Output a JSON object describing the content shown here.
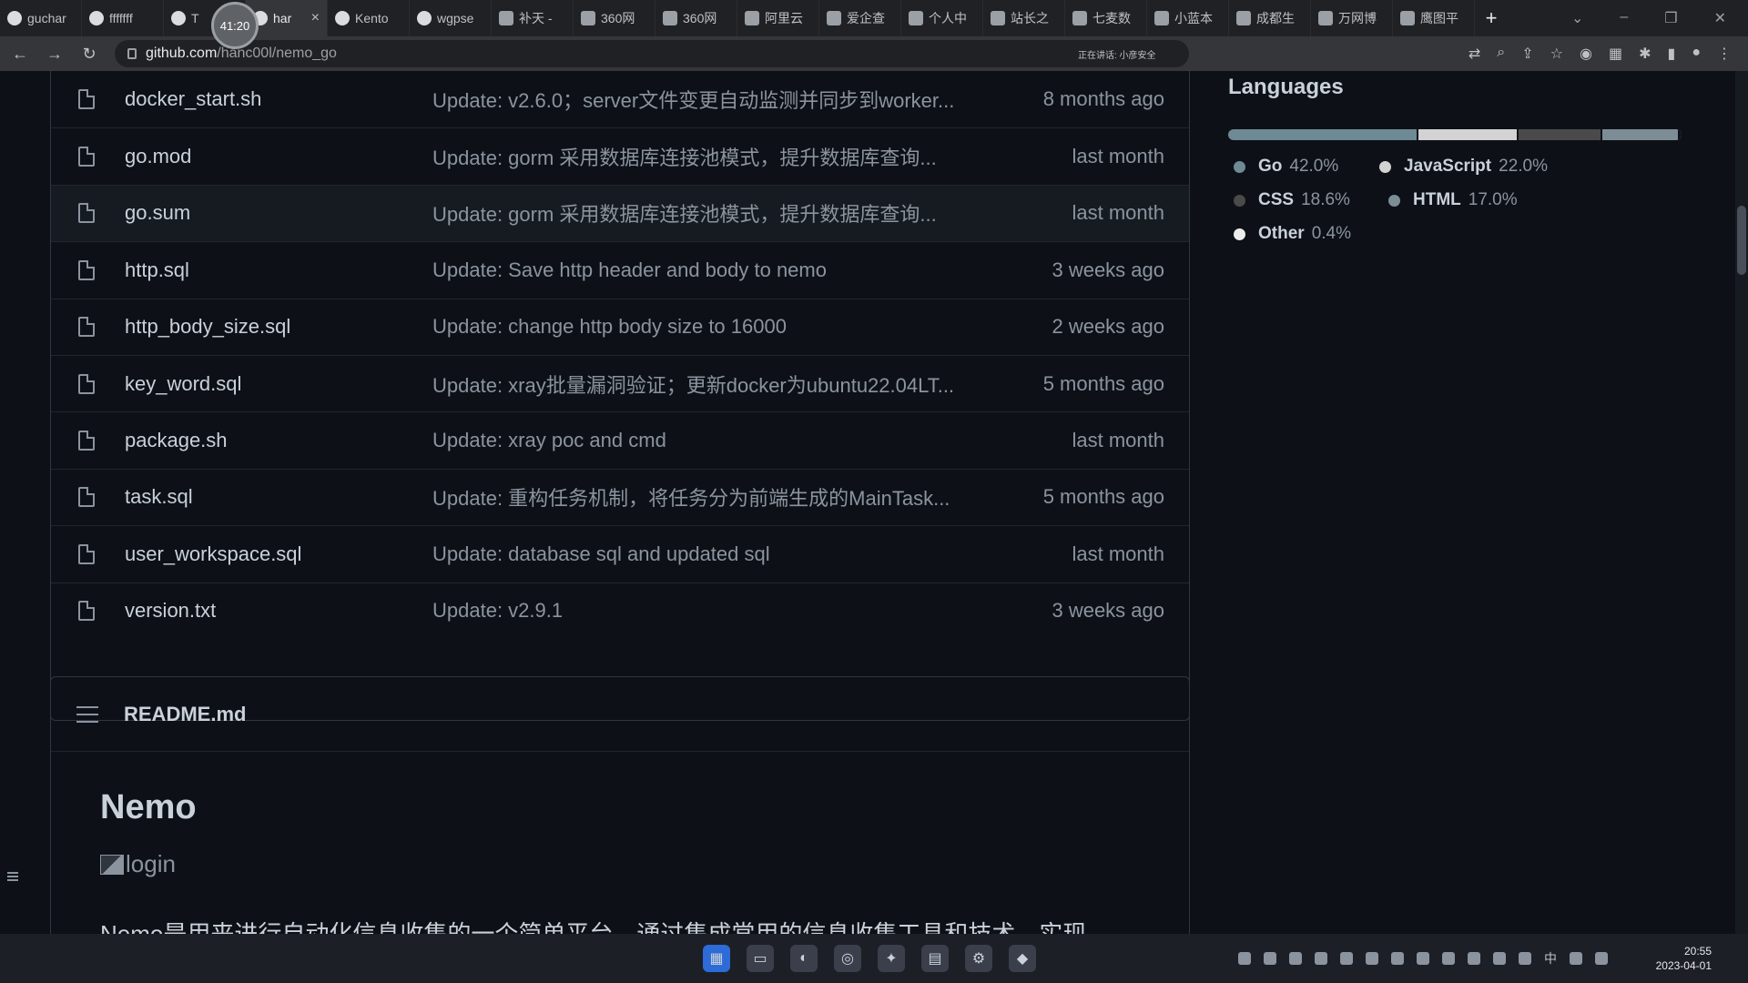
{
  "browser": {
    "tabs": [
      {
        "label": "guchar",
        "icon": "github-icon"
      },
      {
        "label": "fffffff",
        "icon": "github-icon"
      },
      {
        "label": "T",
        "icon": "github-icon"
      },
      {
        "label": "har",
        "icon": "github-icon",
        "active": true
      },
      {
        "label": "Kento",
        "icon": "github-icon"
      },
      {
        "label": "wgpse",
        "icon": "github-icon"
      },
      {
        "label": "补天 -",
        "icon": "site-icon"
      },
      {
        "label": "360网",
        "icon": "site-icon"
      },
      {
        "label": "360网",
        "icon": "site-icon"
      },
      {
        "label": "阿里云",
        "icon": "site-icon"
      },
      {
        "label": "爱企查",
        "icon": "site-icon"
      },
      {
        "label": "个人中",
        "icon": "site-icon"
      },
      {
        "label": "站长之",
        "icon": "site-icon"
      },
      {
        "label": "七麦数",
        "icon": "site-icon"
      },
      {
        "label": "小蓝本",
        "icon": "site-icon"
      },
      {
        "label": "成都生",
        "icon": "site-icon"
      },
      {
        "label": "万网博",
        "icon": "site-icon"
      },
      {
        "label": "鹰图平",
        "icon": "site-icon"
      }
    ],
    "new_tab": "+",
    "timer": "41:20",
    "url_host": "github.com",
    "url_path": "/hanc00l/nemo_go",
    "sync_text": "正在讲话: 小彦安全"
  },
  "files": [
    {
      "name": "docker_start.sh",
      "commit": "Update: v2.6.0；server文件变更自动监测并同步到worker...",
      "time": "8 months ago"
    },
    {
      "name": "go.mod",
      "commit": "Update: gorm 采用数据库连接池模式，提升数据库查询...",
      "time": "last month"
    },
    {
      "name": "go.sum",
      "commit": "Update: gorm 采用数据库连接池模式，提升数据库查询...",
      "time": "last month"
    },
    {
      "name": "http.sql",
      "commit": "Update: Save http header and body to nemo",
      "time": "3 weeks ago"
    },
    {
      "name": "http_body_size.sql",
      "commit": "Update: change http body size to 16000",
      "time": "2 weeks ago"
    },
    {
      "name": "key_word.sql",
      "commit": "Update: xray批量漏洞验证；更新docker为ubuntu22.04LT...",
      "time": "5 months ago"
    },
    {
      "name": "package.sh",
      "commit": "Update: xray poc and cmd",
      "time": "last month"
    },
    {
      "name": "task.sql",
      "commit": "Update: 重构任务机制，将任务分为前端生成的MainTask...",
      "time": "5 months ago"
    },
    {
      "name": "user_workspace.sql",
      "commit": "Update: database sql and updated sql",
      "time": "last month"
    },
    {
      "name": "version.txt",
      "commit": "Update: v2.9.1",
      "time": "3 weeks ago"
    }
  ],
  "readme": {
    "filename": "README.md",
    "heading": "Nemo",
    "image_alt": "login",
    "truncated_line": "Nemo是用来进行自动化信息收集的一个简单平台，通过集成常用的信息收集工具和技术，实现"
  },
  "languages": {
    "title": "Languages",
    "items": [
      {
        "name": "Go",
        "percent": "42.0%",
        "value": 42.0,
        "color": "#6e8a94"
      },
      {
        "name": "JavaScript",
        "percent": "22.0%",
        "value": 22.0,
        "color": "#d3d3d3"
      },
      {
        "name": "CSS",
        "percent": "18.6%",
        "value": 18.6,
        "color": "#4a4a4a"
      },
      {
        "name": "HTML",
        "percent": "17.0%",
        "value": 17.0,
        "color": "#7c8d96"
      },
      {
        "name": "Other",
        "percent": "0.4%",
        "value": 0.4,
        "color": "#ededed"
      }
    ]
  },
  "taskbar": {
    "clock_time": "20:55",
    "clock_date": "2023-04-01",
    "ime": "中"
  }
}
